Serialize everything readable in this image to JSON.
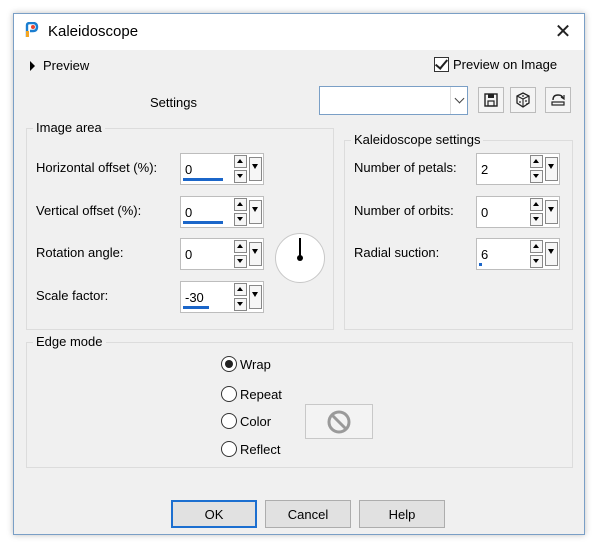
{
  "window": {
    "title": "Kaleidoscope",
    "close_glyph": "✕"
  },
  "preview": {
    "label": "Preview",
    "preview_on_image_label": "Preview on Image",
    "preview_on_image_checked": true
  },
  "settings": {
    "label": "Settings",
    "preset_value": ""
  },
  "toolbar": {
    "icons": [
      "save-preset-icon",
      "random-dice-icon",
      "reset-icon"
    ]
  },
  "image_area": {
    "title": "Image area",
    "horizontal_offset": {
      "label": "Horizontal offset (%):",
      "value": "0"
    },
    "vertical_offset": {
      "label": "Vertical offset (%):",
      "value": "0"
    },
    "rotation_angle": {
      "label": "Rotation angle:",
      "value": "0"
    },
    "scale_factor": {
      "label": "Scale factor:",
      "value": "-30"
    }
  },
  "kaleidoscope": {
    "title": "Kaleidoscope settings",
    "petals": {
      "label": "Number of petals:",
      "value": "2"
    },
    "orbits": {
      "label": "Number of orbits:",
      "value": "0"
    },
    "radial_suction": {
      "label": "Radial suction:",
      "value": "6"
    }
  },
  "edge_mode": {
    "title": "Edge mode",
    "options": [
      "Wrap",
      "Repeat",
      "Color",
      "Reflect"
    ],
    "selected": "Wrap"
  },
  "buttons": {
    "ok": "OK",
    "cancel": "Cancel",
    "help": "Help"
  },
  "colors": {
    "accent": "#1b66c9",
    "dialog_bg": "#f0f0f0"
  }
}
